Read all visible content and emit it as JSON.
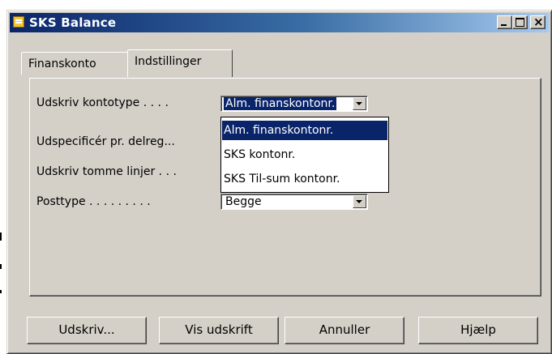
{
  "window": {
    "title": "SKS Balance",
    "controls": {
      "minimize": "minimize",
      "maximize": "maximize",
      "close": "×"
    }
  },
  "tabs": [
    {
      "label": "Finanskonto",
      "active": false
    },
    {
      "label": "Indstillinger",
      "active": true
    }
  ],
  "fields": {
    "udskriv_kontotype": {
      "label": "Udskriv kontotype . . . .",
      "value": "Alm. finanskontonr."
    },
    "udspecificer": {
      "label": "Udspecificér pr. delreg..."
    },
    "udskriv_tomme_linjer": {
      "label": "Udskriv tomme linjer . . ."
    },
    "posttype": {
      "label": "Posttype . . . . . . . . .",
      "value": "Begge"
    }
  },
  "dropdown": {
    "options": [
      "Alm. finanskontonr.",
      "SKS kontonr.",
      "SKS Til-sum kontonr."
    ],
    "highlighted": "Alm. finanskontonr."
  },
  "buttons": {
    "print": "Udskriv...",
    "preview": "Vis udskrift",
    "cancel": "Annuller",
    "help": "Hjælp"
  },
  "colors": {
    "title_bar_start": "#0a246a",
    "title_bar_end": "#a6caf0",
    "face": "#d4d0c8",
    "highlight": "#0a246a"
  }
}
